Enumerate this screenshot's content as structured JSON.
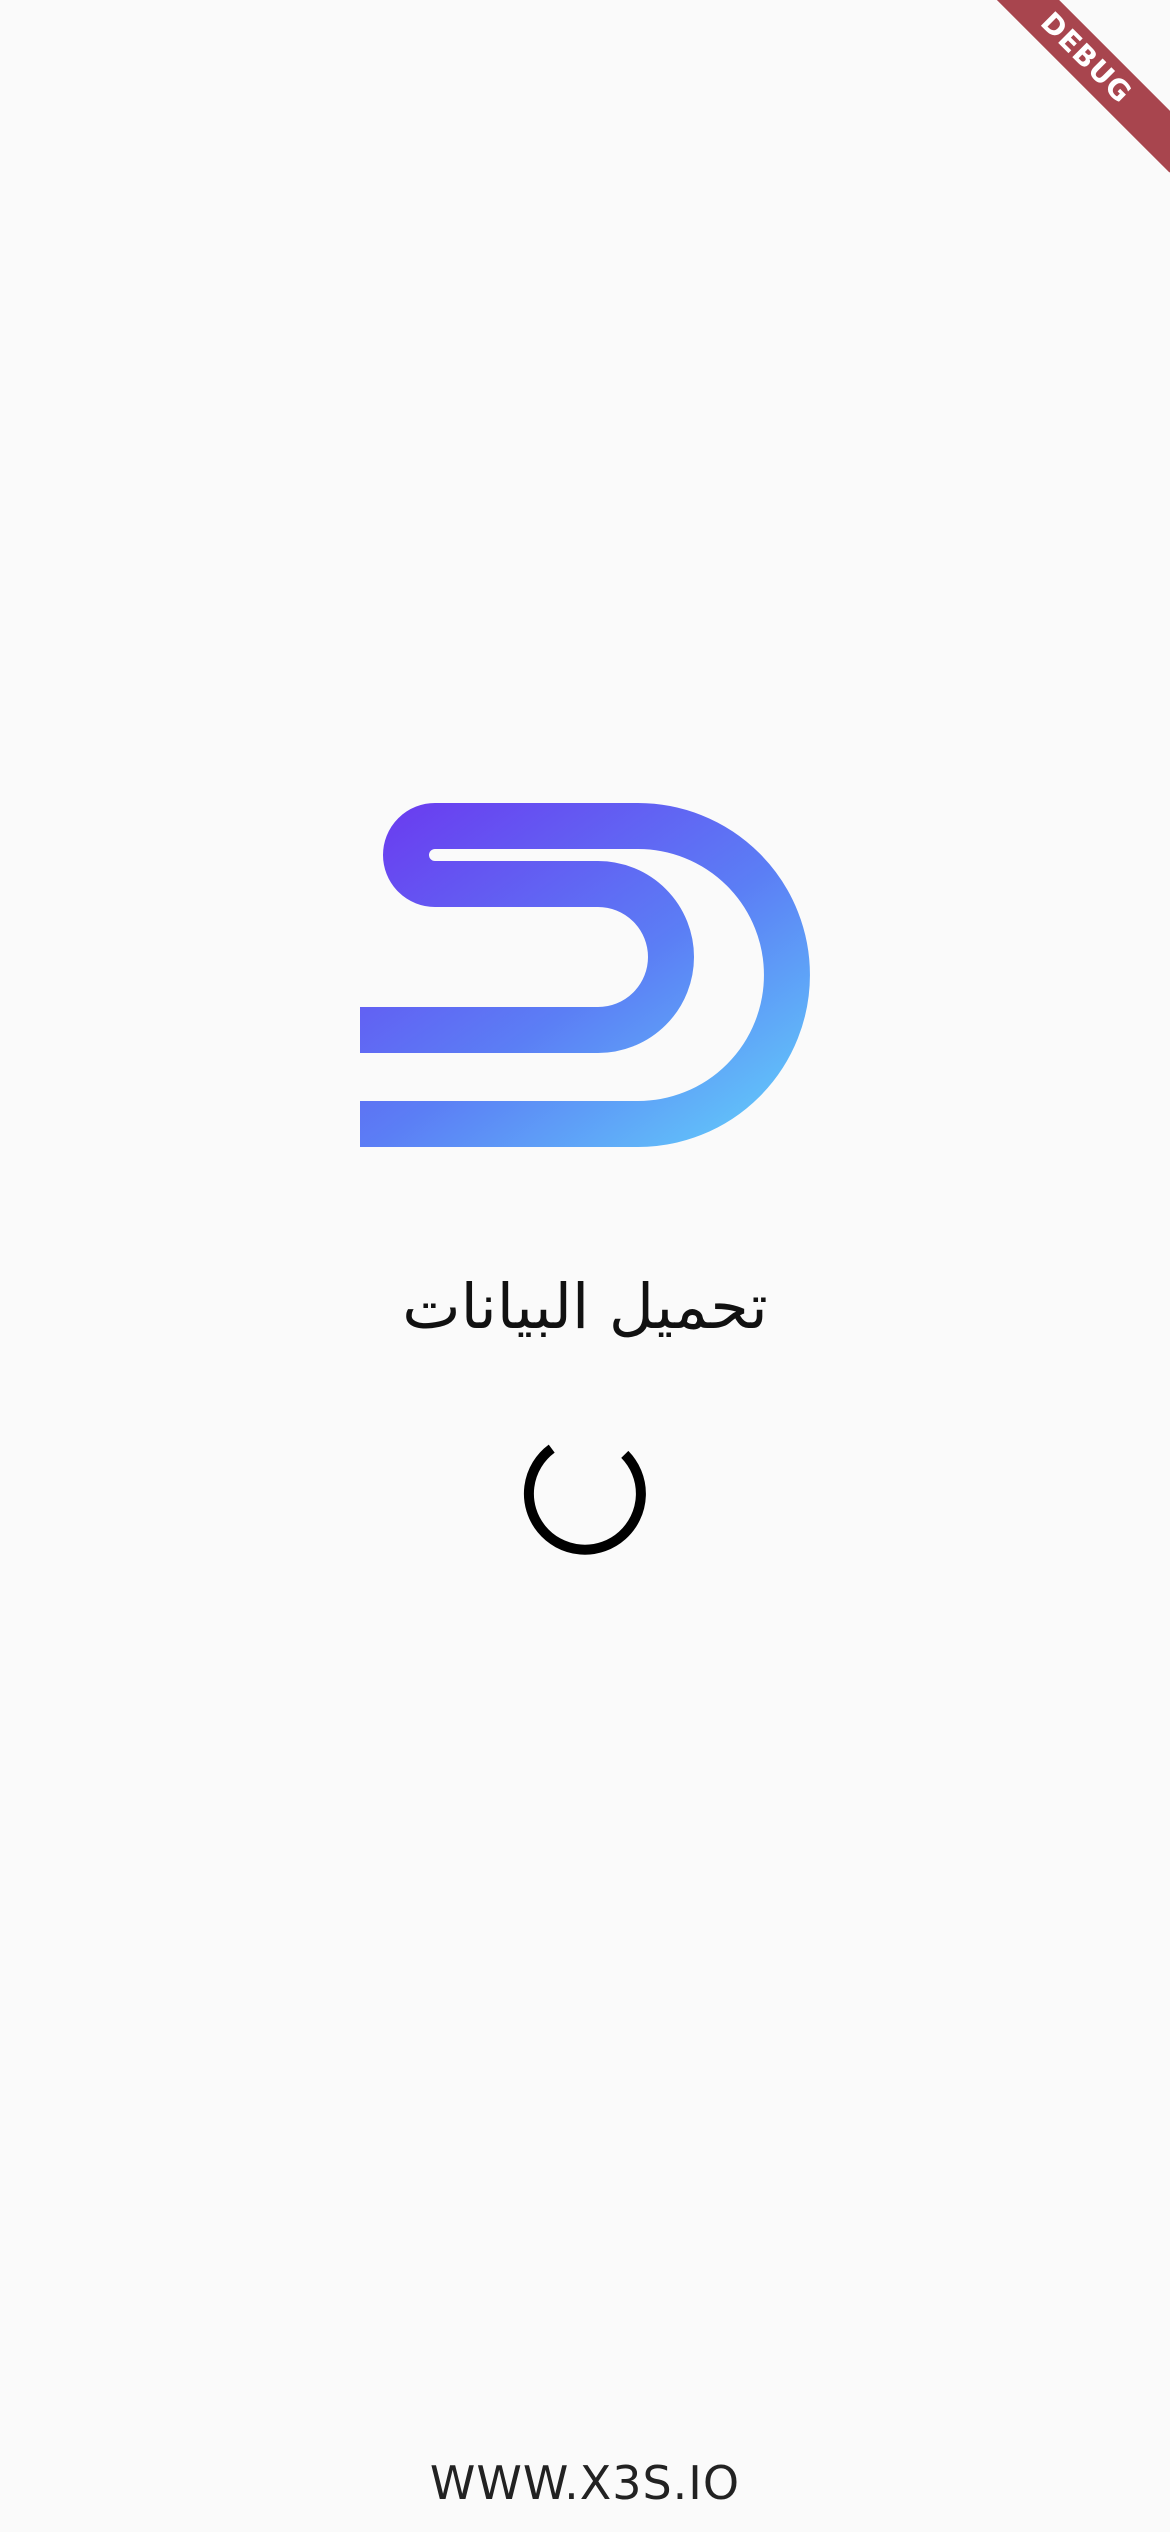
{
  "debug_banner": {
    "label": "DEBUG",
    "color": "#a8454e"
  },
  "logo": {
    "name": "s-logo",
    "gradient": [
      "#6a3cf0",
      "#5b7ef5",
      "#62c8fa"
    ]
  },
  "loading": {
    "text": "تحميل البيانات"
  },
  "spinner": {
    "icon": "loading-spinner-icon"
  },
  "footer": {
    "url": "WWW.X3S.IO"
  }
}
